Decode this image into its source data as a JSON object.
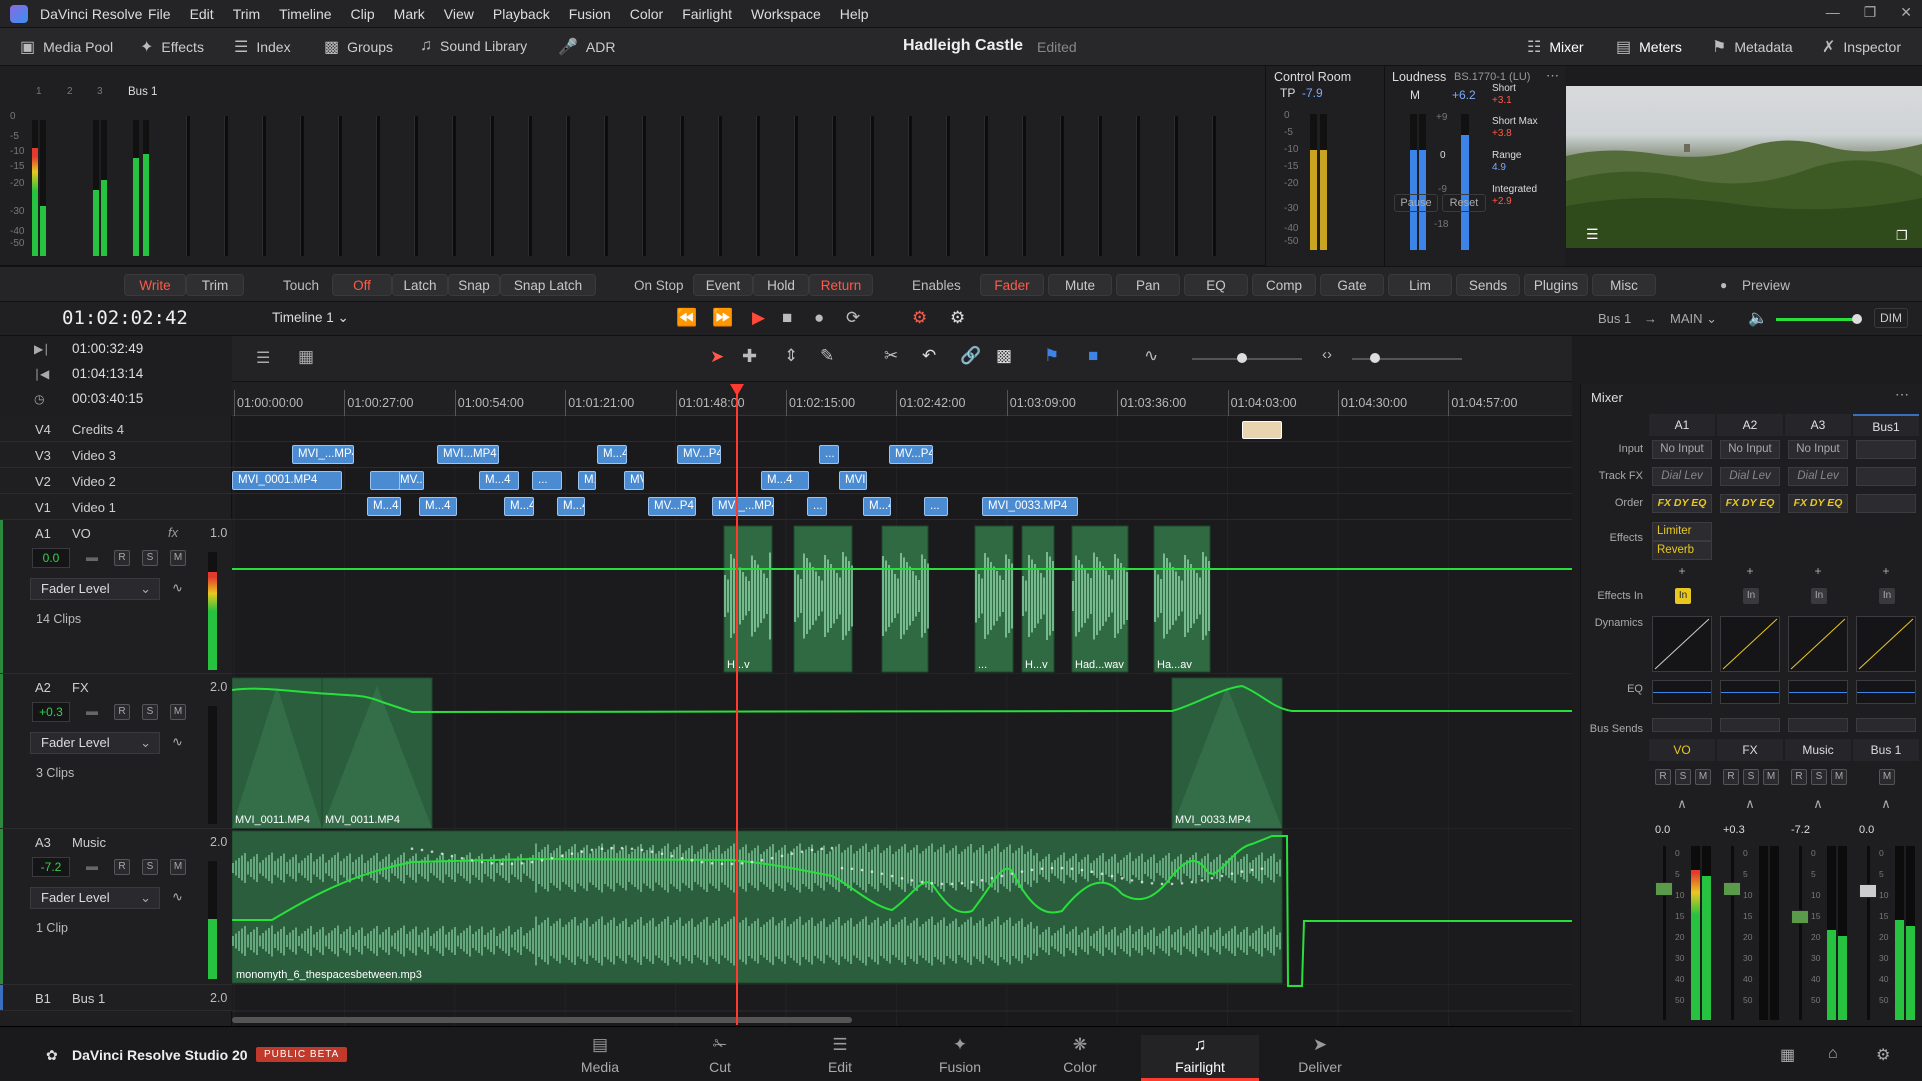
{
  "app": {
    "title": "DaVinci Resolve",
    "menus": [
      "File",
      "Edit",
      "Trim",
      "Timeline",
      "Clip",
      "Mark",
      "View",
      "Playback",
      "Fusion",
      "Color",
      "Fairlight",
      "Workspace",
      "Help"
    ]
  },
  "toolbar": {
    "media_pool": "Media Pool",
    "effects": "Effects",
    "index": "Index",
    "groups": "Groups",
    "sound_library": "Sound Library",
    "adr": "ADR",
    "project_title": "Hadleigh Castle",
    "project_status": "Edited",
    "mixer": "Mixer",
    "meters": "Meters",
    "metadata": "Metadata",
    "inspector": "Inspector"
  },
  "meters_panel": {
    "channels": [
      "1",
      "2",
      "3"
    ],
    "bus_label": "Bus 1",
    "scale": [
      "0",
      "-5",
      "-10",
      "-15",
      "-20",
      "-30",
      "-40",
      "-50"
    ]
  },
  "control_room": {
    "label": "Control Room",
    "tp_label": "TP",
    "tp_value": "-7.9",
    "scale": [
      "0",
      "-5",
      "-10",
      "-15",
      "-20",
      "-30",
      "-40",
      "-50"
    ]
  },
  "loudness": {
    "label": "Loudness",
    "standard": "BS.1770-1 (LU)",
    "m_label": "M",
    "m_value": "+6.2",
    "scale": [
      "+9",
      "0",
      "-9",
      "-18"
    ],
    "short_label": "Short",
    "short_value": "+3.1",
    "short_max_label": "Short Max",
    "short_max_value": "+3.8",
    "range_label": "Range",
    "range_value": "4.9",
    "integrated_label": "Integrated",
    "integrated_value": "+2.9",
    "pause": "Pause",
    "reset": "Reset"
  },
  "automation": {
    "write": "Write",
    "trim": "Trim",
    "touch_label": "Touch",
    "off": "Off",
    "latch": "Latch",
    "snap": "Snap",
    "snap_latch": "Snap Latch",
    "on_stop_label": "On Stop",
    "event": "Event",
    "hold": "Hold",
    "return": "Return",
    "enables_label": "Enables",
    "enables": [
      "Fader",
      "Mute",
      "Pan",
      "EQ",
      "Comp",
      "Gate",
      "Lim",
      "Sends",
      "Plugins",
      "Misc"
    ],
    "preview": "Preview"
  },
  "transport": {
    "timecode": "01:02:02:42",
    "timeline_name": "Timeline 1",
    "bus_out": "Bus 1",
    "main_out": "MAIN",
    "dim": "DIM",
    "tc_in": "01:00:32:49",
    "tc_out": "01:04:13:14",
    "tc_dur": "00:03:40:15"
  },
  "ruler": [
    "01:00:00:00",
    "01:00:27:00",
    "01:00:54:00",
    "01:01:21:00",
    "01:01:48:00",
    "01:02:15:00",
    "01:02:42:00",
    "01:03:09:00",
    "01:03:36:00",
    "01:04:03:00",
    "01:04:30:00",
    "01:04:57:00"
  ],
  "video_tracks": [
    {
      "id": "V4",
      "name": "Credits 4",
      "clips": []
    },
    {
      "id": "V3",
      "name": "Video 3",
      "clips": [
        "MVI_...MP4",
        "MVI...MP4",
        "M...4",
        "MV...P4",
        "...",
        "MV...P4"
      ]
    },
    {
      "id": "V2",
      "name": "Video 2",
      "clips": [
        "MVI_0001.MP4",
        "M...4",
        "MV...P4",
        "M...4",
        "...",
        "M...4",
        "MVI...MP4",
        "M...4",
        "MVI...MP4"
      ]
    },
    {
      "id": "V1",
      "name": "Video 1",
      "clips": [
        "M...4",
        "M...4",
        "M...4",
        "M...4",
        "MV...P4",
        "MVI_...MP4",
        "...",
        "M...4",
        "...",
        "MVI_0033.MP4"
      ]
    }
  ],
  "audio_tracks": [
    {
      "id": "A1",
      "name": "VO",
      "gain": "1.0",
      "level": "0.0",
      "mode": "Fader Level",
      "clip_count": "14 Clips",
      "clips": [
        "H...v",
        "...",
        "H...v",
        "Had...wav",
        "Ha...av"
      ]
    },
    {
      "id": "A2",
      "name": "FX",
      "gain": "2.0",
      "level": "+0.3",
      "mode": "Fader Level",
      "clip_count": "3 Clips",
      "clips": [
        "MVI_0011.MP4",
        "MVI_0011.MP4",
        "MVI_0033.MP4"
      ]
    },
    {
      "id": "A3",
      "name": "Music",
      "gain": "2.0",
      "level": "-7.2",
      "mode": "Fader Level",
      "clip_count": "1 Clip",
      "clips": [
        "monomyth_6_thespacesbetween.mp3"
      ]
    },
    {
      "id": "B1",
      "name": "Bus 1",
      "gain": "2.0"
    }
  ],
  "track_buttons": {
    "r": "R",
    "s": "S",
    "m": "M",
    "fx": "fx"
  },
  "mixer": {
    "title": "Mixer",
    "row_labels": {
      "input": "Input",
      "track_fx": "Track FX",
      "order": "Order",
      "effects": "Effects",
      "effects_in": "Effects In",
      "dynamics": "Dynamics",
      "eq": "EQ",
      "bus_sends": "Bus Sends"
    },
    "channels": [
      {
        "id": "A1",
        "input": "No Input",
        "track_fx": "Dial Lev",
        "order": "FX DY EQ",
        "effects": [
          "Limiter",
          "Reverb"
        ],
        "name": "VO",
        "level": "0.0"
      },
      {
        "id": "A2",
        "input": "No Input",
        "track_fx": "Dial Lev",
        "order": "FX DY EQ",
        "effects": [],
        "name": "FX",
        "level": "+0.3"
      },
      {
        "id": "A3",
        "input": "No Input",
        "track_fx": "Dial Lev",
        "order": "FX DY EQ",
        "effects": [],
        "name": "Music",
        "level": "-7.2"
      },
      {
        "id": "Bus1",
        "input": "",
        "track_fx": "",
        "order": "",
        "effects": [],
        "name": "Bus 1",
        "level": "0.0"
      }
    ],
    "fader_scale": [
      "0",
      "5",
      "10",
      "15",
      "20",
      "30",
      "40",
      "50"
    ],
    "in_label": "In",
    "plus": "+"
  },
  "footer": {
    "product": "DaVinci Resolve Studio 20",
    "badge": "PUBLIC BETA",
    "pages": [
      "Media",
      "Cut",
      "Edit",
      "Fusion",
      "Color",
      "Fairlight",
      "Deliver"
    ],
    "active_page": "Fairlight"
  },
  "colors": {
    "accent": "#ff3b30",
    "clip_video": "#4a8bd1",
    "clip_audio": "#2f6a42",
    "automation": "#28e03c"
  }
}
